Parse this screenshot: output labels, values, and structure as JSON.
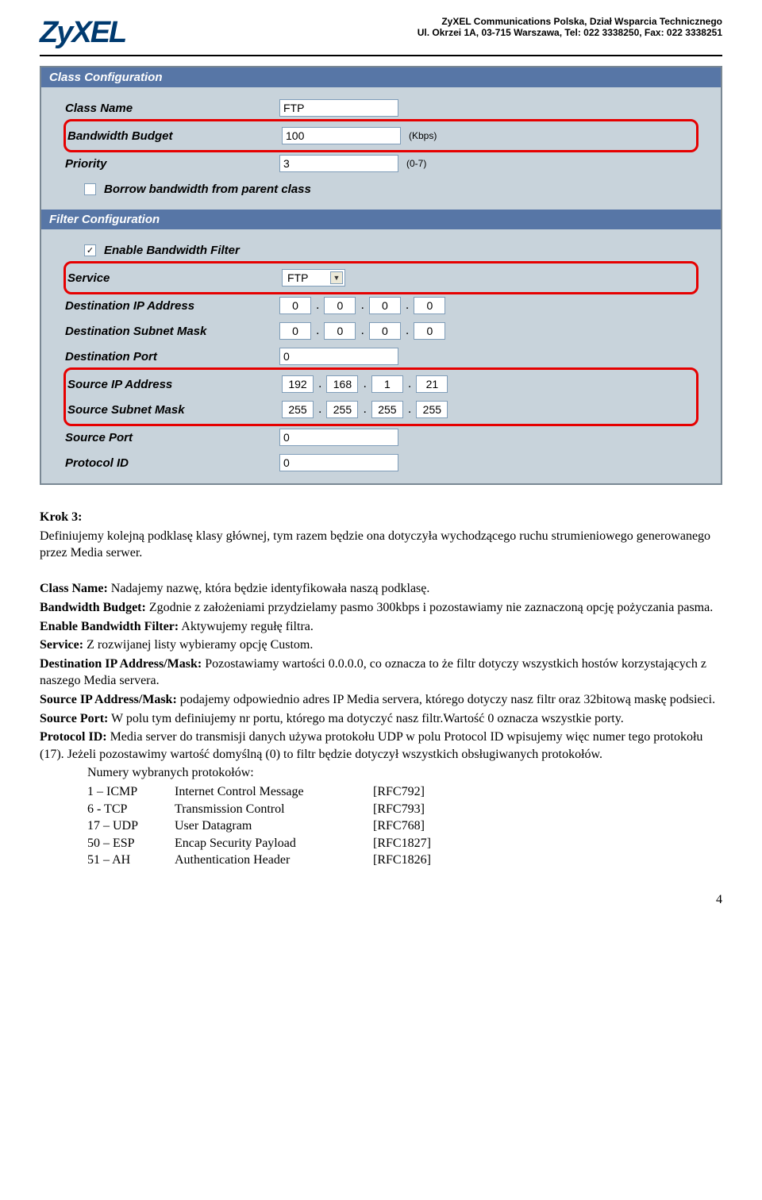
{
  "header": {
    "logo": "ZyXEL",
    "line1": "ZyXEL Communications Polska, Dział Wsparcia Technicznego",
    "line2": "Ul. Okrzei 1A, 03-715 Warszawa, Tel: 022 3338250, Fax: 022 3338251"
  },
  "panel": {
    "classConfigTitle": "Class Configuration",
    "classNameLabel": "Class Name",
    "classNameValue": "FTP",
    "bwBudgetLabel": "Bandwidth Budget",
    "bwBudgetValue": "100",
    "bwBudgetHint": "(Kbps)",
    "priorityLabel": "Priority",
    "priorityValue": "3",
    "priorityHint": "(0-7)",
    "borrowLabel": "Borrow bandwidth from parent class",
    "filterConfigTitle": "Filter Configuration",
    "enableFilterLabel": "Enable Bandwidth Filter",
    "enableFilterChecked": "✓",
    "serviceLabel": "Service",
    "serviceValue": "FTP",
    "destIpLabel": "Destination IP Address",
    "destIp": [
      "0",
      "0",
      "0",
      "0"
    ],
    "destMaskLabel": "Destination Subnet Mask",
    "destMask": [
      "0",
      "0",
      "0",
      "0"
    ],
    "destPortLabel": "Destination Port",
    "destPortValue": "0",
    "srcIpLabel": "Source IP Address",
    "srcIp": [
      "192",
      "168",
      "1",
      "21"
    ],
    "srcMaskLabel": "Source Subnet Mask",
    "srcMask": [
      "255",
      "255",
      "255",
      "255"
    ],
    "srcPortLabel": "Source Port",
    "srcPortValue": "0",
    "protoIdLabel": "Protocol ID",
    "protoIdValue": "0"
  },
  "text": {
    "krokTitle": "Krok 3:",
    "p1": "Definiujemy kolejną podklasę klasy głównej, tym razem będzie ona dotyczyła wychodzącego ruchu strumieniowego generowanego przez Media serwer.",
    "l1b": "Class Name:",
    "l1": " Nadajemy nazwę, która będzie identyfikowała naszą podklasę.",
    "l2b": "Bandwidth Budget:",
    "l2": " Zgodnie z założeniami przydzielamy pasmo 300kbps i pozostawiamy nie zaznaczoną opcję pożyczania pasma.",
    "l3b": "Enable Bandwidth Filter:",
    "l3": " Aktywujemy regułę filtra.",
    "l4b": "Service:",
    "l4": " Z rozwijanej listy wybieramy opcję Custom.",
    "l5b": "Destination IP Address/Mask:",
    "l5": " Pozostawiamy wartości 0.0.0.0, co oznacza to że filtr dotyczy wszystkich hostów korzystających z naszego Media servera.",
    "l6b": "Source IP Address/Mask:",
    "l6": " podajemy odpowiednio adres IP Media servera, którego dotyczy nasz filtr oraz 32bitową maskę podsieci.",
    "l7b": "Source Port:",
    "l7": " W polu tym definiujemy nr portu, którego ma dotyczyć nasz filtr.Wartość 0 oznacza wszystkie porty.",
    "l8b": "Protocol ID:",
    "l8": " Media server do transmisji danych używa protokołu UDP w polu Protocol ID wpisujemy więc numer tego protokołu (17). Jeżeli pozostawimy wartość domyślną (0) to filtr będzie dotyczył wszystkich obsługiwanych protokołów.",
    "protoIntro": "Numery wybranych protokołów:",
    "protos": [
      {
        "num": "1 – ICMP",
        "name": "Internet Control Message",
        "rfc": "[RFC792]"
      },
      {
        "num": "6 - TCP",
        "name": "Transmission Control",
        "rfc": "[RFC793]"
      },
      {
        "num": "17 – UDP",
        "name": "User Datagram",
        "rfc": "[RFC768]"
      },
      {
        "num": "50 – ESP",
        "name": "Encap Security Payload",
        "rfc": "[RFC1827]"
      },
      {
        "num": "51 – AH",
        "name": "Authentication Header",
        "rfc": "[RFC1826]"
      }
    ],
    "pageNum": "4"
  }
}
